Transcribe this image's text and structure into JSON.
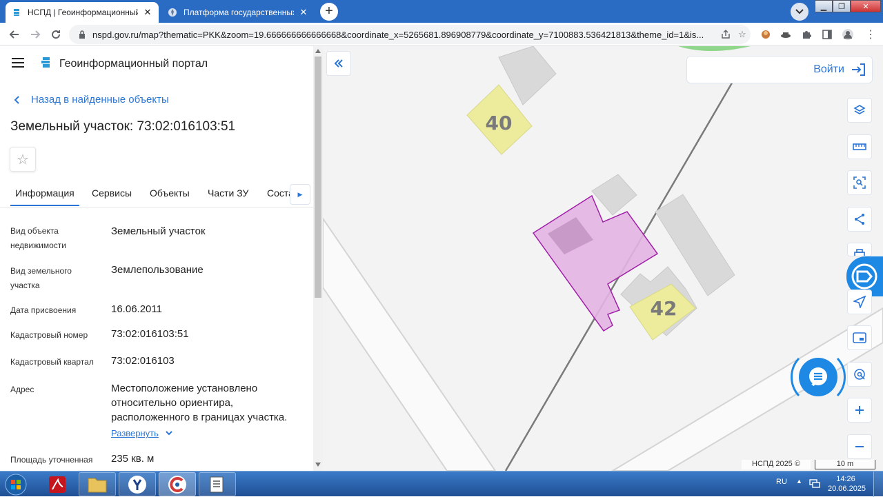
{
  "browser": {
    "tabs": [
      {
        "title": "НСПД | Геоинформационный п",
        "active": true
      },
      {
        "title": "Платформа государственных се",
        "active": false
      }
    ],
    "url": "nspd.gov.ru/map?thematic=PKK&zoom=19.666666666666668&coordinate_x=5265681.896908779&coordinate_y=7100883.536421813&theme_id=1&is..."
  },
  "sidebar": {
    "portal_title": "Геоинформационный портал",
    "back_label": "Назад в найденные объекты",
    "object_title": "Земельный участок: 73:02:016103:51",
    "tabs": [
      "Информация",
      "Сервисы",
      "Объекты",
      "Части ЗУ",
      "Соста"
    ],
    "properties": [
      {
        "label": "Вид объекта недвижимости",
        "value": "Земельный участок"
      },
      {
        "label": "Вид земельного участка",
        "value": "Землепользование"
      },
      {
        "label": "Дата присвоения",
        "value": "16.06.2011"
      },
      {
        "label": "Кадастровый номер",
        "value": "73:02:016103:51"
      },
      {
        "label": "Кадастровый квартал",
        "value": "73:02:016103"
      },
      {
        "label": "Адрес",
        "value": "Местоположение установлено относительно ориентира, расположенного в границах участка."
      },
      {
        "label": "Площадь уточненная",
        "value": "235 кв. м"
      }
    ],
    "expand_label": "Развернуть"
  },
  "map": {
    "login_label": "Войти",
    "house_numbers": [
      "40",
      "42"
    ],
    "copyright": "НСПД 2025 ©",
    "scale": "10 m",
    "colors": {
      "parcel_fill": "#e3b5e3",
      "parcel_stroke": "#a020a8",
      "house_fill": "#ecec9c",
      "building": "#d6d6d6",
      "accent": "#2a75d6"
    }
  },
  "taskbar": {
    "lang": "RU",
    "time": "14:26",
    "date": "20.06.2025"
  }
}
